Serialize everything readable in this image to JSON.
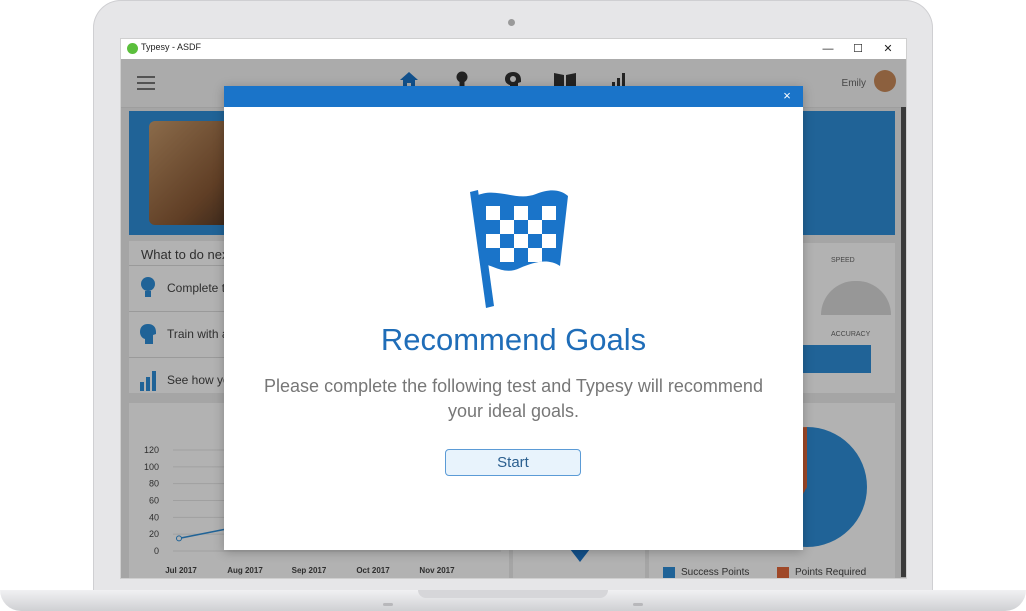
{
  "window": {
    "title": "Typesy - ASDF",
    "controls": {
      "minimize": "—",
      "maximize": "☐",
      "close": "✕"
    }
  },
  "app": {
    "nav": {
      "icons": [
        "home-icon",
        "lightbulb-icon",
        "brain-icon",
        "book-icon",
        "bar-chart-icon"
      ],
      "user_name": "Emily"
    },
    "what_to_do": {
      "title": "What to do next",
      "items": [
        {
          "label": "Complete the",
          "icon": "lightbulb-icon"
        },
        {
          "label": "Train with a",
          "icon": "brain-icon"
        },
        {
          "label": "See how yo",
          "icon": "bar-chart-icon"
        }
      ]
    },
    "stats": {
      "speed_label": "SPEED",
      "accuracy_label": "ACCURACY"
    },
    "legend": {
      "success_points": "Success Points",
      "points_required": "Points Required"
    }
  },
  "chart_data": {
    "type": "line",
    "categories": [
      "Jul 2017",
      "Aug 2017",
      "Sep 2017",
      "Oct 2017",
      "Nov 2017"
    ],
    "series": [
      {
        "values": [
          15,
          30,
          null,
          null,
          null
        ]
      }
    ],
    "y_ticks": [
      0,
      20,
      40,
      60,
      80,
      100,
      120
    ],
    "ylim": [
      0,
      120
    ],
    "grid": true
  },
  "pie_data": {
    "type": "pie",
    "slices": [
      {
        "label": "Success Points",
        "color": "#2e8fd8"
      },
      {
        "label": "Points Required",
        "color": "#e4683a"
      }
    ]
  },
  "modal": {
    "title": "Recommend Goals",
    "description": "Please complete the following test and Typesy will recommend your ideal goals.",
    "start_label": "Start",
    "close_label": "×",
    "colors": {
      "header": "#1a74c9",
      "title": "#1f6db8"
    }
  }
}
